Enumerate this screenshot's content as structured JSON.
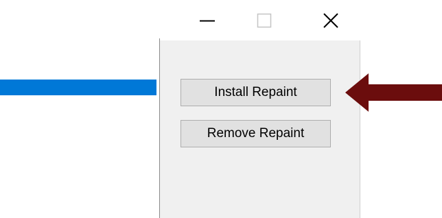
{
  "window": {
    "controls": {
      "minimize_icon": "minimize-icon",
      "maximize_icon": "maximize-icon",
      "close_icon": "close-icon"
    }
  },
  "buttons": {
    "install_label": "Install Repaint",
    "remove_label": "Remove Repaint"
  },
  "colors": {
    "selection": "#0078d7",
    "client_bg": "#f0f0f0",
    "button_bg": "#e1e1e1",
    "arrow": "#6b0d0d"
  }
}
